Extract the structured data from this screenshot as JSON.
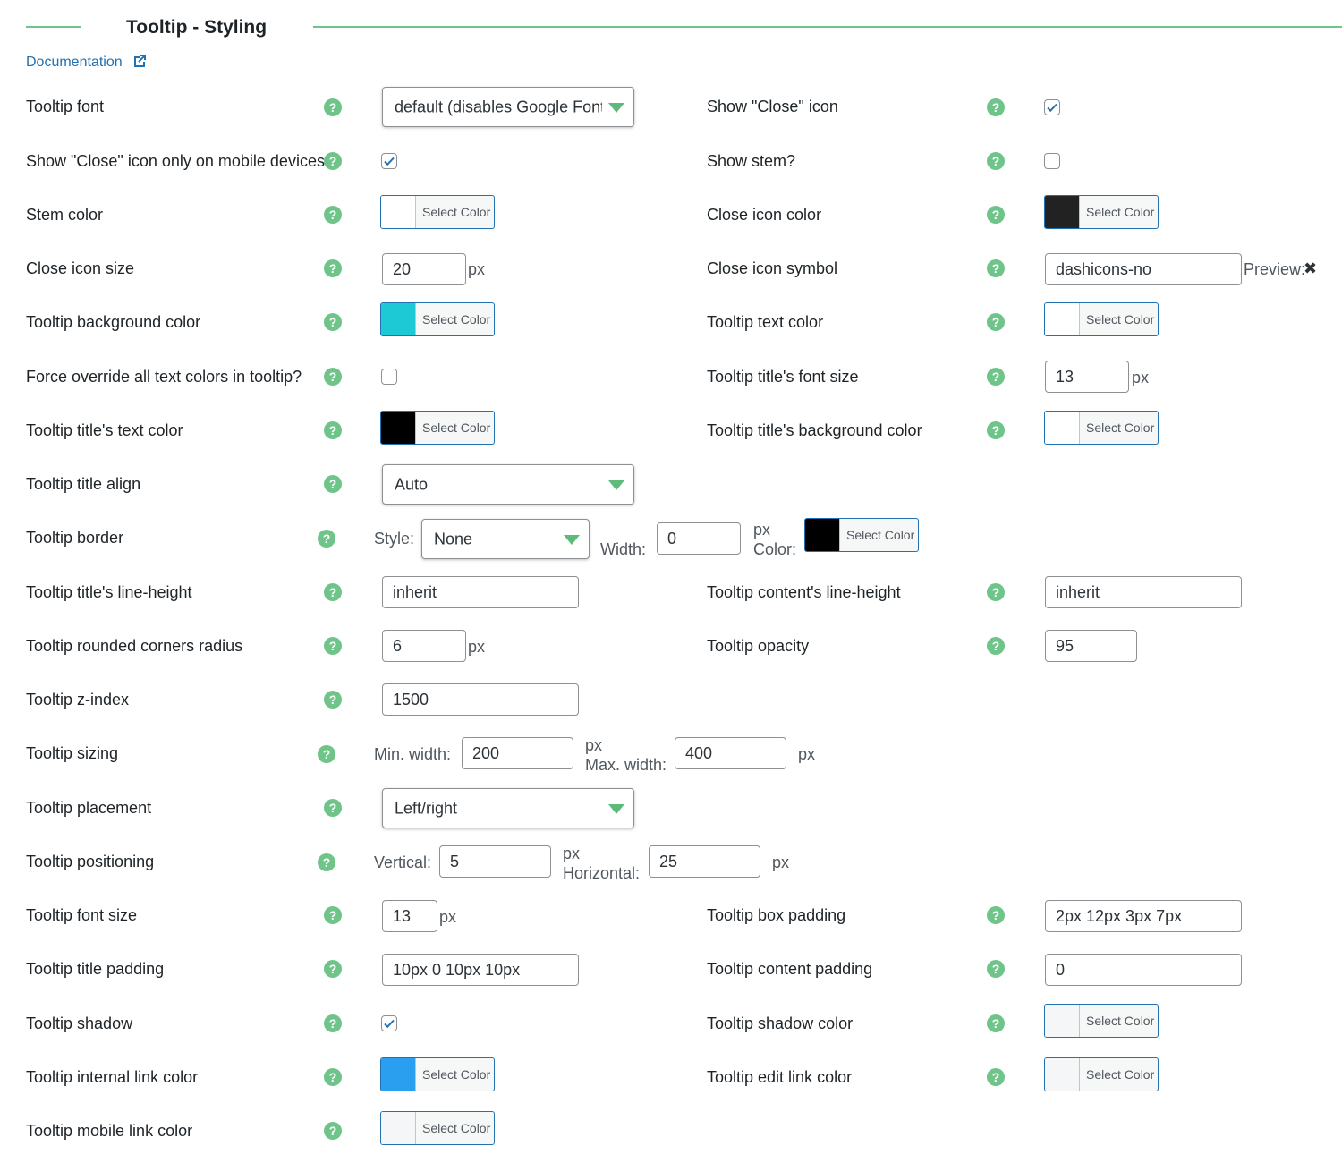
{
  "header": {
    "title": "Tooltip - Styling",
    "documentation_link": "Documentation",
    "icon": "external-link-icon"
  },
  "common": {
    "help_glyph": "?",
    "select_color": "Select Color",
    "px": "px"
  },
  "fields": {
    "tooltip_font": {
      "label": "Tooltip font",
      "value": "default (disables Google Fonts)"
    },
    "show_close_icon": {
      "label": "Show \"Close\" icon",
      "checked": true
    },
    "close_icon_mobile_only": {
      "label": "Show \"Close\" icon only on mobile devices",
      "checked": true
    },
    "show_stem": {
      "label": "Show stem?",
      "checked": false
    },
    "stem_color": {
      "label": "Stem color",
      "color": "#ffffff"
    },
    "close_icon_color": {
      "label": "Close icon color",
      "color": "#222222"
    },
    "close_icon_size": {
      "label": "Close icon size",
      "value": "20"
    },
    "close_icon_symbol": {
      "label": "Close icon symbol",
      "value": "dashicons-no",
      "preview_label": "Preview:",
      "preview_glyph": "✖"
    },
    "tooltip_bg_color": {
      "label": "Tooltip background color",
      "color": "#1ec9d6"
    },
    "tooltip_text_color": {
      "label": "Tooltip text color",
      "color": "#ffffff"
    },
    "force_override_text_colors": {
      "label": "Force override all text colors in tooltip?",
      "checked": false
    },
    "title_font_size": {
      "label": "Tooltip title's font size",
      "value": "13"
    },
    "title_text_color": {
      "label": "Tooltip title's text color",
      "color": "#000000"
    },
    "title_bg_color": {
      "label": "Tooltip title's background color",
      "color": "#ffffff"
    },
    "title_align": {
      "label": "Tooltip title align",
      "value": "Auto"
    },
    "tooltip_border": {
      "label": "Tooltip border",
      "style_label": "Style:",
      "style_value": "None",
      "width_label": "Width:",
      "width_value": "0",
      "color_label": "Color:",
      "color": "#000000"
    },
    "title_line_height": {
      "label": "Tooltip title's line-height",
      "value": "inherit"
    },
    "content_line_height": {
      "label": "Tooltip content's line-height",
      "value": "inherit"
    },
    "rounded_corners": {
      "label": "Tooltip rounded corners radius",
      "value": "6"
    },
    "opacity": {
      "label": "Tooltip opacity",
      "value": "95"
    },
    "z_index": {
      "label": "Tooltip z-index",
      "value": "1500"
    },
    "sizing": {
      "label": "Tooltip sizing",
      "min_label": "Min. width:",
      "min_value": "200",
      "max_label": "Max. width:",
      "max_value": "400"
    },
    "placement": {
      "label": "Tooltip placement",
      "value": "Left/right"
    },
    "positioning": {
      "label": "Tooltip positioning",
      "vertical_label": "Vertical:",
      "vertical_value": "5",
      "horizontal_label": "Horizontal:",
      "horizontal_value": "25"
    },
    "font_size": {
      "label": "Tooltip font size",
      "value": "13"
    },
    "box_padding": {
      "label": "Tooltip box padding",
      "value": "2px 12px 3px 7px"
    },
    "title_padding": {
      "label": "Tooltip title padding",
      "value": "10px 0 10px 10px"
    },
    "content_padding": {
      "label": "Tooltip content padding",
      "value": "0"
    },
    "shadow": {
      "label": "Tooltip shadow",
      "checked": true
    },
    "shadow_color": {
      "label": "Tooltip shadow color",
      "color": "#f5f6f7"
    },
    "internal_link_color": {
      "label": "Tooltip internal link color",
      "color": "#2a9ff0"
    },
    "edit_link_color": {
      "label": "Tooltip edit link color",
      "color": "#f5f6f7"
    },
    "mobile_link_color": {
      "label": "Tooltip mobile link color",
      "color": "#f5f6f7"
    }
  }
}
